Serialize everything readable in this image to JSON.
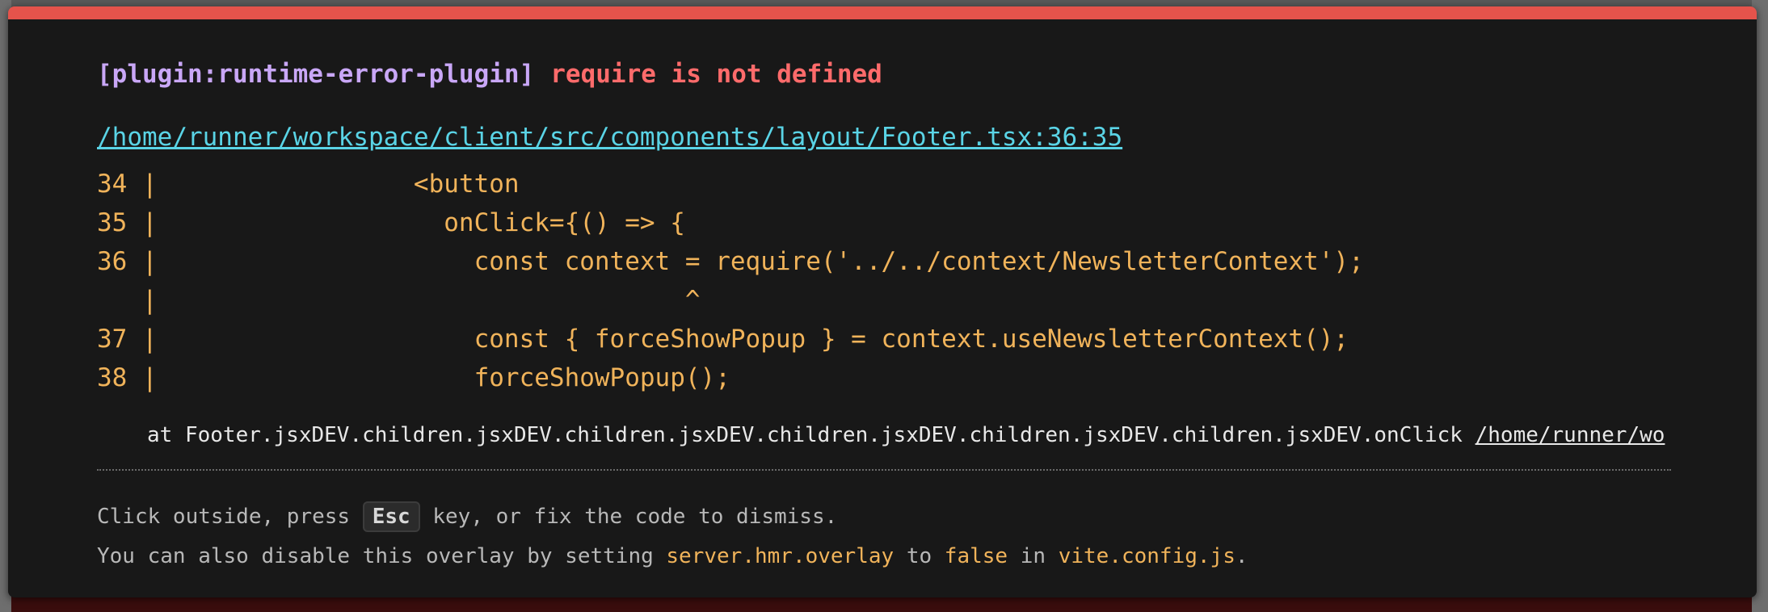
{
  "overlay": {
    "plugin_tag": "[plugin:runtime-error-plugin]",
    "message": "require is not defined",
    "file_link": "/home/runner/workspace/client/src/components/layout/Footer.tsx:36:35",
    "code_lines": [
      "34 |                 <button",
      "35 |                   onClick={() => {",
      "36 |                     const context = require('../../context/NewsletterContext');",
      "   |                                   ^",
      "37 |                     const { forceShowPopup } = context.useNewsletterContext();",
      "38 |                     forceShowPopup();"
    ],
    "stack_text": "at Footer.jsxDEV.children.jsxDEV.children.jsxDEV.children.jsxDEV.children.jsxDEV.children.jsxDEV.onClick ",
    "stack_link": "/home/runner/wo",
    "tip1": {
      "before": "Click outside, press ",
      "key": "Esc",
      "after": " key, or fix the code to dismiss."
    },
    "tip2": {
      "part1": "You can also disable this overlay by setting ",
      "code1": "server.hmr.overlay",
      "part2": " to ",
      "code2": "false",
      "part3": " in ",
      "code3": "vite.config.js",
      "part4": "."
    }
  },
  "colors": {
    "accent_bar": "#e5534b",
    "plugin": "#c9a7f7",
    "message": "#ff6b6b",
    "link": "#5ad4e6",
    "code": "#f0b35a"
  }
}
